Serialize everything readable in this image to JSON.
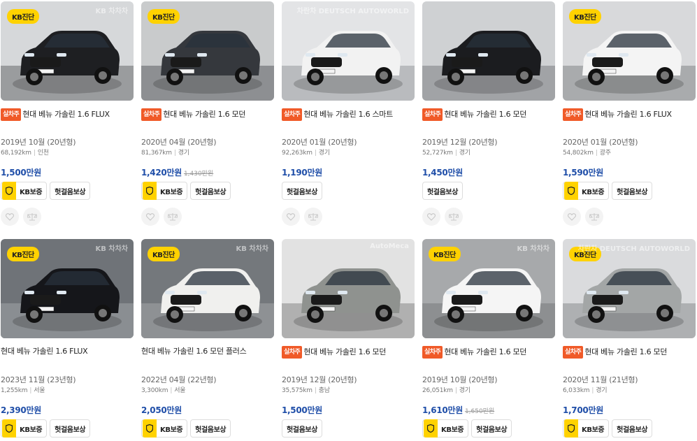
{
  "cards": [
    {
      "badge": "KB진단",
      "tag": "실차주",
      "title": "현대 베뉴 가솔린 1.6 FLUX",
      "year": "2019년 10월 (20년형)",
      "km": "68,192km",
      "region": "인천",
      "price": "1,500만원",
      "old_price": "",
      "kb": "KB보증",
      "warranty": "헛걸음보상",
      "car_color": "#1e1f22",
      "bg": "#d6d8da",
      "floor": "#9a9c9e"
    },
    {
      "badge": "KB진단",
      "tag": "실차주",
      "title": "현대 베뉴 가솔린 1.6 모던",
      "year": "2020년 04월 (20년형)",
      "km": "81,367km",
      "region": "경기",
      "price": "1,420만원",
      "old_price": "1,430만원",
      "kb": "KB보증",
      "warranty": "헛걸음보상",
      "car_color": "#35383d",
      "bg": "#c9cbcc",
      "floor": "#8d8f92"
    },
    {
      "badge": "",
      "tag": "실차주",
      "title": "현대 베뉴 가솔린 1.6 스마트",
      "year": "2020년 01월 (20년형)",
      "km": "92,263km",
      "region": "경기",
      "price": "1,190만원",
      "old_price": "",
      "kb": "",
      "warranty": "헛걸음보상",
      "car_color": "#f2f2f2",
      "bg": "#e3e4e6",
      "floor": "#b9bbbe"
    },
    {
      "badge": "",
      "tag": "실차주",
      "title": "현대 베뉴 가솔린 1.6 모던",
      "year": "2019년 12월 (20년형)",
      "km": "52,727km",
      "region": "경기",
      "price": "1,450만원",
      "old_price": "",
      "kb": "",
      "warranty": "헛걸음보상",
      "car_color": "#1b1c1f",
      "bg": "#cfd1d3",
      "floor": "#a1a3a6"
    },
    {
      "badge": "KB진단",
      "tag": "실차주",
      "title": "현대 베뉴 가솔린 1.6 FLUX",
      "year": "2020년 01월 (20년형)",
      "km": "54,802km",
      "region": "광주",
      "price": "1,590만원",
      "old_price": "",
      "kb": "KB보증",
      "warranty": "헛걸음보상",
      "car_color": "#f4f4f4",
      "bg": "#d8d9db",
      "floor": "#a9abad"
    },
    {
      "badge": "KB진단",
      "tag": "",
      "title": "현대 베뉴 가솔린 1.6 FLUX",
      "year": "2023년 11월 (23년형)",
      "km": "1,255km",
      "region": "서울",
      "price": "2,390만원",
      "old_price": "",
      "kb": "KB보증",
      "warranty": "헛걸음보상",
      "car_color": "#15161a",
      "bg": "#6f7378",
      "floor": "#8a8e92"
    },
    {
      "badge": "KB진단",
      "tag": "",
      "title": "현대 베뉴 가솔린 1.6 모던 플러스",
      "year": "2022년 04월 (22년형)",
      "km": "3,300km",
      "region": "서울",
      "price": "2,050만원",
      "old_price": "",
      "kb": "KB보증",
      "warranty": "헛걸음보상",
      "car_color": "#f0f0ee",
      "bg": "#74787c",
      "floor": "#8e9194"
    },
    {
      "badge": "",
      "tag": "실차주",
      "title": "현대 베뉴 가솔린 1.6 모던",
      "year": "2019년 12월 (20년형)",
      "km": "35,575km",
      "region": "충남",
      "price": "1,500만원",
      "old_price": "",
      "kb": "",
      "warranty": "헛걸음보상",
      "car_color": "#8f928f",
      "bg": "#e2e2e2",
      "floor": "#b0b0b0"
    },
    {
      "badge": "KB진단",
      "tag": "실차주",
      "title": "현대 베뉴 가솔린 1.6 모던",
      "year": "2019년 10월 (20년형)",
      "km": "26,051km",
      "region": "경기",
      "price": "1,610만원",
      "old_price": "1,650만원",
      "kb": "KB보증",
      "warranty": "헛걸음보상",
      "car_color": "#f5f5f5",
      "bg": "#a7a9ab",
      "floor": "#8d8f91"
    },
    {
      "badge": "KB진단",
      "tag": "실차주",
      "title": "현대 베뉴 가솔린 1.6 모던",
      "year": "2020년 11월 (21년형)",
      "km": "6,033km",
      "region": "경기",
      "price": "1,700만원",
      "old_price": "",
      "kb": "KB보증",
      "warranty": "헛걸음보상",
      "car_color": "#a3a6a6",
      "bg": "#dadbdd",
      "floor": "#aeb0b2"
    }
  ],
  "watermarks": [
    "KB 차차차",
    "",
    "차란차 DEUTSCH AUTOWORLD",
    "",
    "",
    "KB 차차차",
    "KB 차차차",
    "AutoMeca",
    "KB 차차차",
    "차란차 DEUTSCH AUTOWORLD"
  ]
}
